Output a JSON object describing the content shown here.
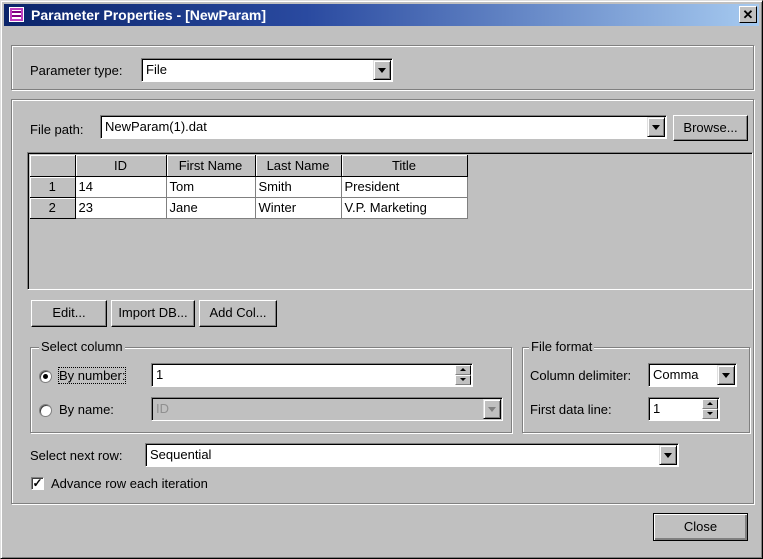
{
  "window": {
    "title": "Parameter Properties - [NewParam]",
    "close_glyph": "✕"
  },
  "param_type": {
    "label": "Parameter type:",
    "value": "File"
  },
  "file_path": {
    "label": "File path:",
    "value": "NewParam(1).dat",
    "browse_label": "Browse..."
  },
  "grid": {
    "columns": [
      "ID",
      "First Name",
      "Last Name",
      "Title"
    ],
    "rows": [
      {
        "num": "1",
        "cells": [
          "14",
          "Tom",
          "Smith",
          "President"
        ]
      },
      {
        "num": "2",
        "cells": [
          "23",
          "Jane",
          "Winter",
          "V.P. Marketing"
        ]
      }
    ]
  },
  "grid_buttons": {
    "edit": "Edit...",
    "import_db": "Import DB...",
    "add_col": "Add Col..."
  },
  "select_column": {
    "legend": "Select column",
    "by_number_label": "By number:",
    "by_number_value": "1",
    "by_name_label": "By name:",
    "by_name_value": "ID",
    "selected": "by_number"
  },
  "file_format": {
    "legend": "File format",
    "delimiter_label": "Column delimiter:",
    "delimiter_value": "Comma",
    "first_line_label": "First data line:",
    "first_line_value": "1"
  },
  "next_row": {
    "label": "Select next row:",
    "value": "Sequential"
  },
  "advance": {
    "label": "Advance row each iteration",
    "checked": true,
    "check_glyph": "✓"
  },
  "footer": {
    "close_label": "Close"
  }
}
